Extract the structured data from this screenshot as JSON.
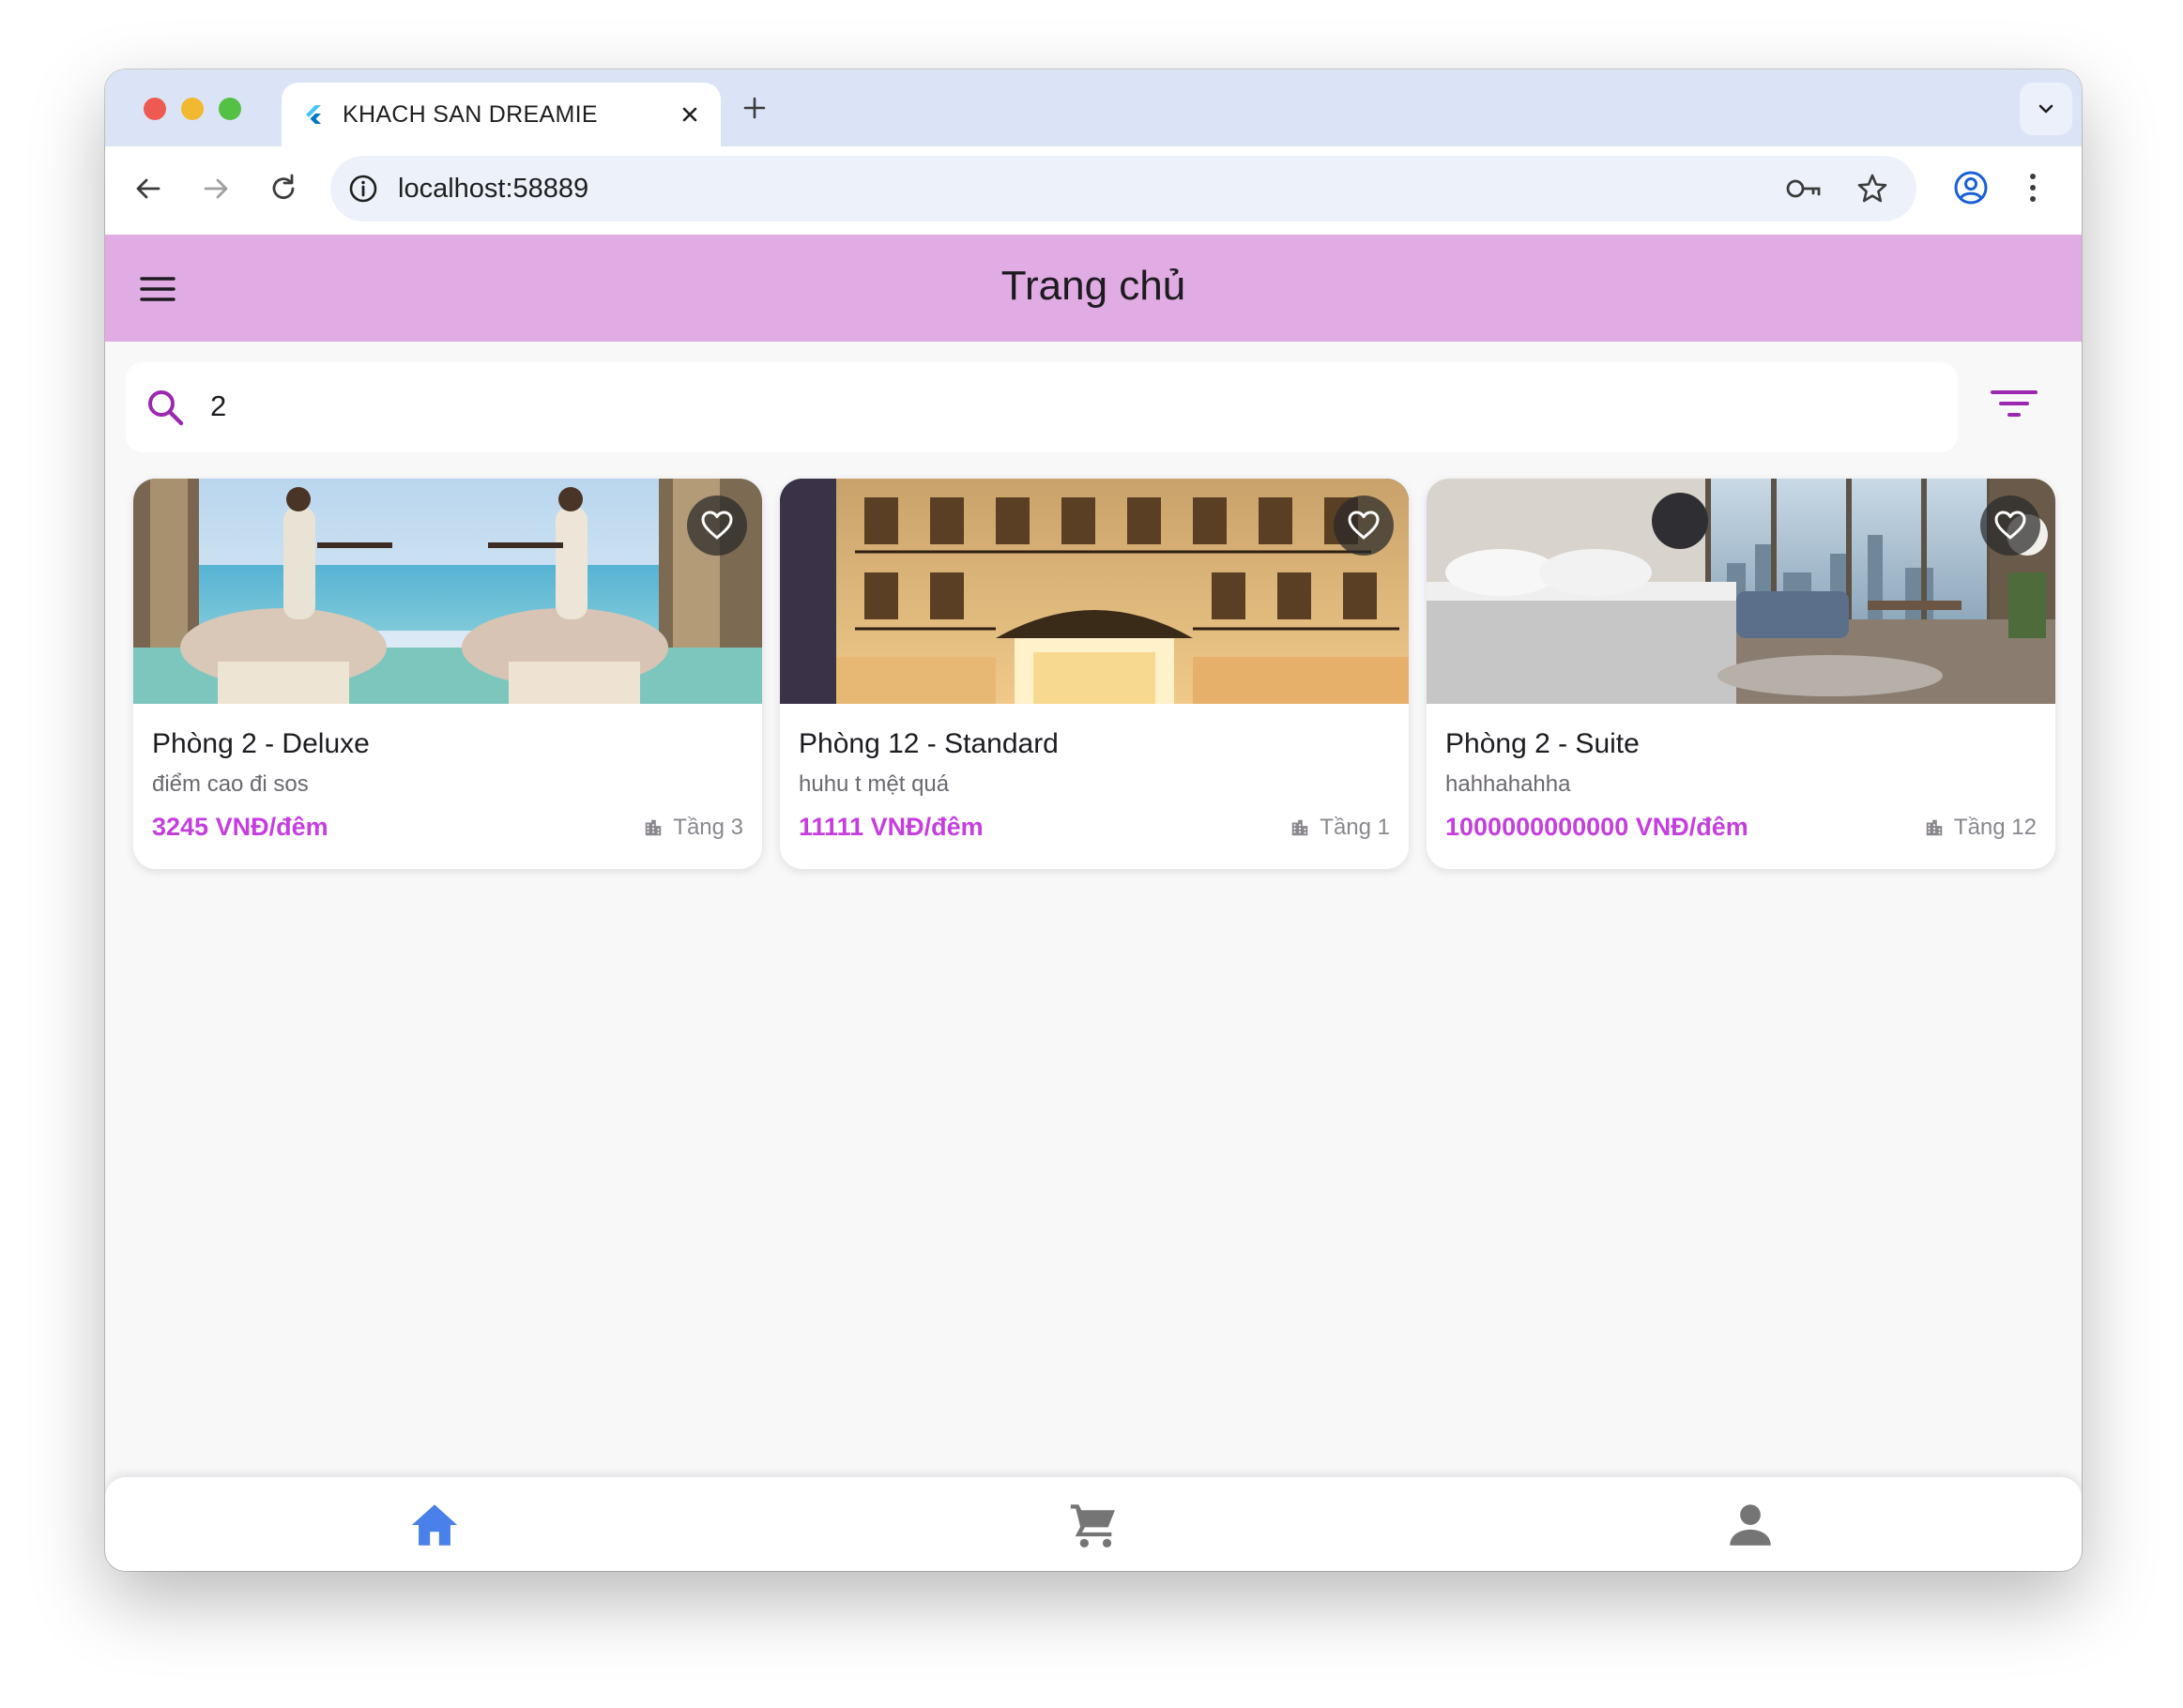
{
  "browser": {
    "tab_title": "KHACH SAN DREAMIE",
    "url": "localhost:58889"
  },
  "appbar": {
    "title": "Trang chủ"
  },
  "search": {
    "value": "2"
  },
  "rooms": [
    {
      "name": "Phòng 2 - Deluxe",
      "description": "điểm cao đi sos",
      "price": "3245 VNĐ/đêm",
      "floor": "Tầng 3",
      "image": "spa-photo"
    },
    {
      "name": "Phòng 12 - Standard",
      "description": "huhu t mệt quá",
      "price": "11111 VNĐ/đêm",
      "floor": "Tầng 1",
      "image": "hotel-facade-photo"
    },
    {
      "name": "Phòng 2 - Suite",
      "description": "hahhahahha",
      "price": "1000000000000 VNĐ/đêm",
      "floor": "Tầng 12",
      "image": "bedroom-photo"
    }
  ],
  "bottom_nav": [
    {
      "icon": "home-icon",
      "active": true
    },
    {
      "icon": "cart-icon",
      "active": false
    },
    {
      "icon": "person-icon",
      "active": false
    }
  ],
  "colors": {
    "appbar": "#e1abe3",
    "accent": "#9c27b0",
    "price": "#c43fde",
    "nav_active": "#4a80ea",
    "nav_inactive": "#757575"
  }
}
